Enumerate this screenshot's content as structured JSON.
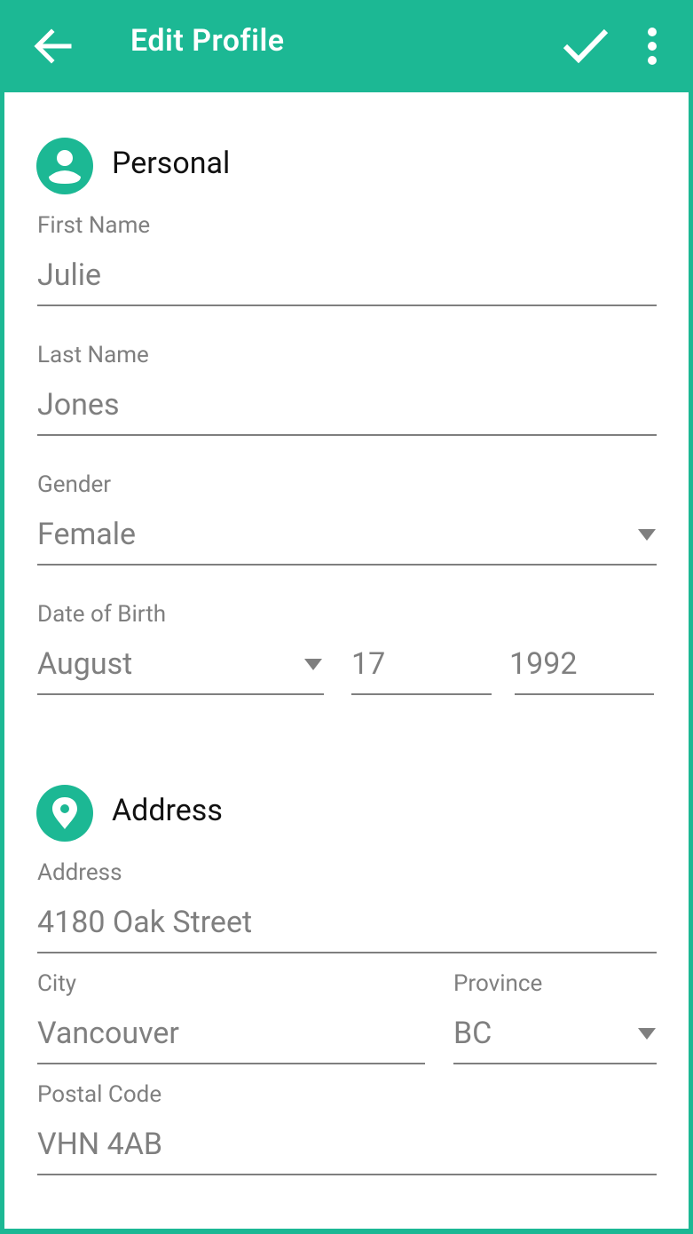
{
  "app_bar": {
    "title": "Edit Profile",
    "back_icon": "arrow-back-icon",
    "save_icon": "checkmark-icon",
    "more_icon": "more-vertical-icon",
    "color": "#1cb894"
  },
  "personal": {
    "title": "Personal",
    "icon": "person-icon",
    "first_name": {
      "label": "First Name",
      "value": "Julie"
    },
    "last_name": {
      "label": "Last Name",
      "value": "Jones"
    },
    "gender": {
      "label": "Gender",
      "value": "Female"
    },
    "dob": {
      "label": "Date of Birth",
      "month": "August",
      "day": "17",
      "year": "1992"
    }
  },
  "address": {
    "title": "Address",
    "icon": "location-pin-icon",
    "street": {
      "label": "Address",
      "value": "4180 Oak Street"
    },
    "city": {
      "label": "City",
      "value": "Vancouver"
    },
    "province": {
      "label": "Province",
      "value": "BC"
    },
    "postal": {
      "label": "Postal Code",
      "value": "VHN 4AB"
    }
  },
  "colors": {
    "accent": "#1cb894",
    "field_text": "#7f7f7f",
    "heading": "#111111"
  }
}
